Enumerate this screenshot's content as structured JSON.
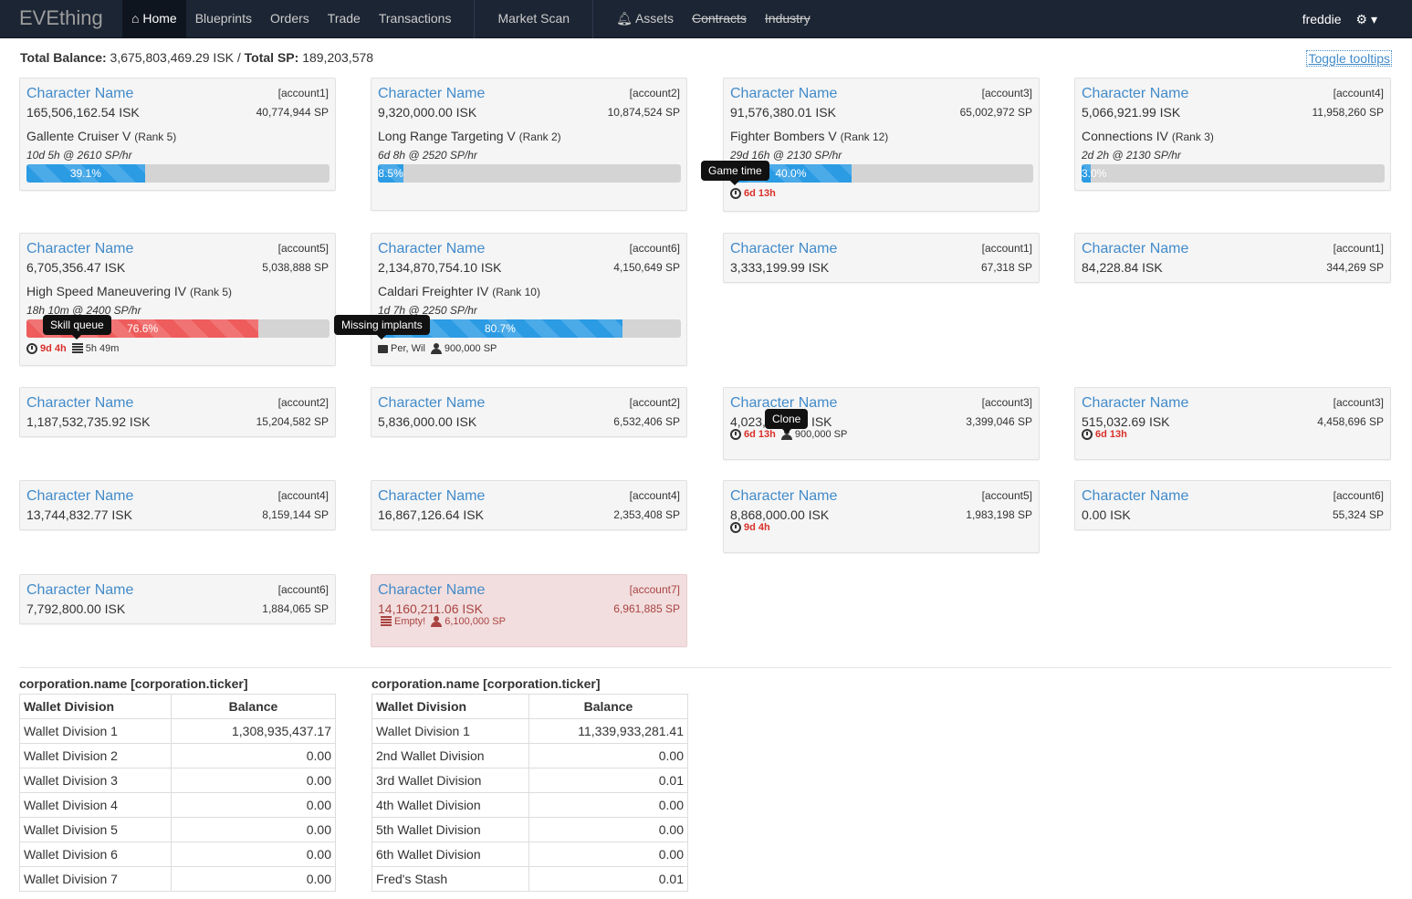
{
  "nav": {
    "brand": "EVEthing",
    "home": "Home",
    "blueprints": "Blueprints",
    "orders": "Orders",
    "trade": "Trade",
    "transactions": "Transactions",
    "market_scan": "Market Scan",
    "assets": "Assets",
    "contracts": "Contracts",
    "industry": "Industry",
    "user": "freddie"
  },
  "summary": {
    "balance_label": "Total Balance:",
    "balance": "3,675,803,469.29 ISK",
    "sep": "/",
    "sp_label": "Total SP:",
    "sp": "189,203,578",
    "toggle": "Toggle tooltips"
  },
  "cards": [
    {
      "name": "Character Name",
      "account": "[account1]",
      "isk": "165,506,162.54 ISK",
      "sp": "40,774,944 SP",
      "skill": "Gallente Cruiser V",
      "rank": "(Rank 5)",
      "time": "10d 5h @ 2610 SP/hr",
      "progress": "39.1%",
      "progress_value": 39.1
    },
    {
      "name": "Character Name",
      "account": "[account2]",
      "isk": "9,320,000.00 ISK",
      "sp": "10,874,524 SP",
      "skill": "Long Range Targeting V",
      "rank": "(Rank 2)",
      "time": "6d 8h @ 2520 SP/hr",
      "progress": "8.5%",
      "progress_value": 8.5
    },
    {
      "name": "Character Name",
      "account": "[account3]",
      "isk": "91,576,380.01 ISK",
      "sp": "65,002,972 SP",
      "skill": "Fighter Bombers V",
      "rank": "(Rank 12)",
      "time": "29d 16h @ 2130 SP/hr",
      "progress": "40.0%",
      "progress_value": 40.0,
      "foot_time": "6d 13h"
    },
    {
      "name": "Character Name",
      "account": "[account4]",
      "isk": "5,066,921.99 ISK",
      "sp": "11,958,260 SP",
      "skill": "Connections IV",
      "rank": "(Rank 3)",
      "time": "2d 2h @ 2130 SP/hr",
      "progress": "3.0%",
      "progress_value": 3.0
    },
    {
      "name": "Character Name",
      "account": "[account5]",
      "isk": "6,705,356.47 ISK",
      "sp": "5,038,888 SP",
      "skill": "High Speed Maneuvering IV",
      "rank": "(Rank 5)",
      "time": "18h 10m @ 2400 SP/hr",
      "progress": "76.6%",
      "progress_value": 76.6,
      "foot_time": "9d 4h",
      "foot_queue": "5h 49m"
    },
    {
      "name": "Character Name",
      "account": "[account6]",
      "isk": "2,134,870,754.10 ISK",
      "sp": "4,150,649 SP",
      "skill": "Caldari Freighter IV",
      "rank": "(Rank 10)",
      "time": "1d 7h @ 2250 SP/hr",
      "progress": "80.7%",
      "progress_value": 80.7,
      "foot_implants": "Per, Wil",
      "foot_clone": "900,000 SP"
    },
    {
      "name": "Character Name",
      "account": "[account1]",
      "isk": "3,333,199.99 ISK",
      "sp": "67,318 SP"
    },
    {
      "name": "Character Name",
      "account": "[account1]",
      "isk": "84,228.84 ISK",
      "sp": "344,269 SP"
    },
    {
      "name": "Character Name",
      "account": "[account2]",
      "isk": "1,187,532,735.92 ISK",
      "sp": "15,204,582 SP"
    },
    {
      "name": "Character Name",
      "account": "[account2]",
      "isk": "5,836,000.00 ISK",
      "sp": "6,532,406 SP"
    },
    {
      "name": "Character Name",
      "account": "[account3]",
      "isk": "4,023,",
      "isk_tail": "ISK",
      "sp": "3,399,046 SP",
      "foot_time": "6d 13h",
      "foot_clone": "900,000 SP"
    },
    {
      "name": "Character Name",
      "account": "[account3]",
      "isk": "515,032.69 ISK",
      "sp": "4,458,696 SP",
      "foot_time": "6d 13h"
    },
    {
      "name": "Character Name",
      "account": "[account4]",
      "isk": "13,744,832.77 ISK",
      "sp": "8,159,144 SP"
    },
    {
      "name": "Character Name",
      "account": "[account4]",
      "isk": "16,867,126.64 ISK",
      "sp": "2,353,408 SP"
    },
    {
      "name": "Character Name",
      "account": "[account5]",
      "isk": "8,868,000.00 ISK",
      "sp": "1,983,198 SP",
      "foot_time": "9d 4h"
    },
    {
      "name": "Character Name",
      "account": "[account6]",
      "isk": "0.00 ISK",
      "sp": "55,324 SP"
    },
    {
      "name": "Character Name",
      "account": "[account6]",
      "isk": "7,792,800.00 ISK",
      "sp": "1,884,065 SP"
    },
    {
      "name": "Character Name",
      "account": "[account7]",
      "isk": "14,160,211.06 ISK",
      "sp": "6,961,885 SP",
      "foot_queue": "Empty!",
      "foot_clone": "6,100,000 SP"
    }
  ],
  "tooltips": {
    "game_time": "Game time",
    "skill_queue": "Skill queue",
    "missing_implants": "Missing implants",
    "clone": "Clone"
  },
  "corps": [
    {
      "title": "corporation.name [corporation.ticker]",
      "col1": "Wallet Division",
      "col2": "Balance",
      "rows": [
        [
          "Wallet Division 1",
          "1,308,935,437.17"
        ],
        [
          "Wallet Division 2",
          "0.00"
        ],
        [
          "Wallet Division 3",
          "0.00"
        ],
        [
          "Wallet Division 4",
          "0.00"
        ],
        [
          "Wallet Division 5",
          "0.00"
        ],
        [
          "Wallet Division 6",
          "0.00"
        ],
        [
          "Wallet Division 7",
          "0.00"
        ]
      ]
    },
    {
      "title": "corporation.name [corporation.ticker]",
      "col1": "Wallet Division",
      "col2": "Balance",
      "rows": [
        [
          "Wallet Division 1",
          "11,339,933,281.41"
        ],
        [
          "2nd Wallet Division",
          "0.00"
        ],
        [
          "3rd Wallet Division",
          "0.01"
        ],
        [
          "4th Wallet Division",
          "0.00"
        ],
        [
          "5th Wallet Division",
          "0.00"
        ],
        [
          "6th Wallet Division",
          "0.00"
        ],
        [
          "Fred's Stash",
          "0.01"
        ]
      ]
    }
  ]
}
